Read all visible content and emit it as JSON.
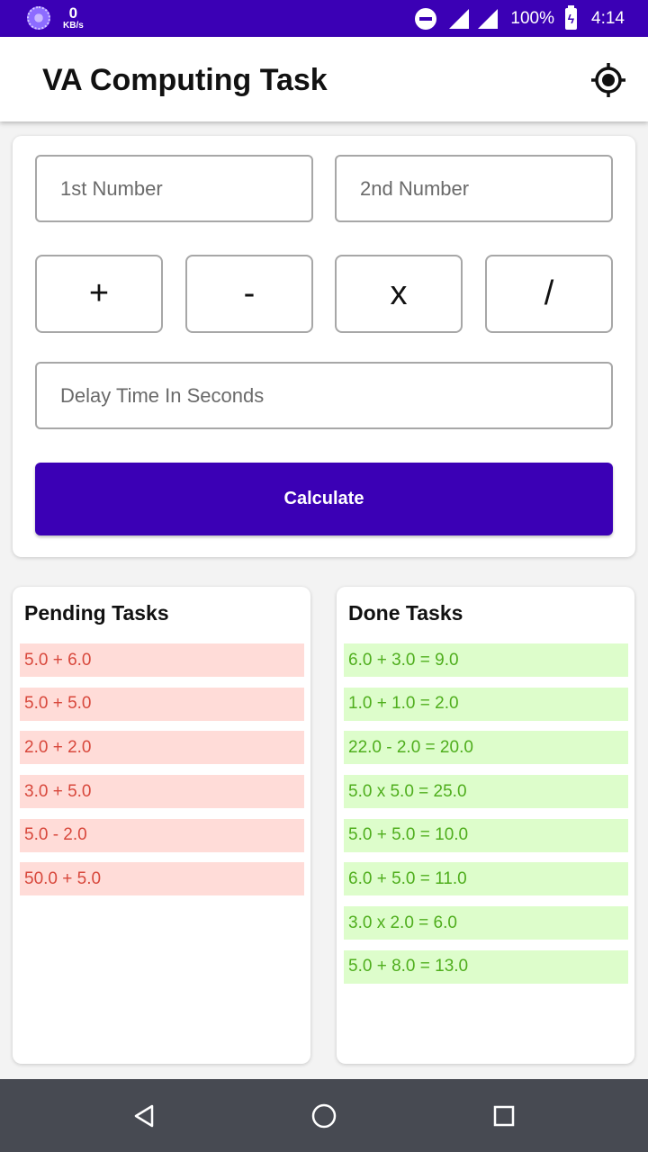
{
  "status_bar": {
    "net_speed_value": "0",
    "net_speed_unit": "KB/s",
    "battery": "100%",
    "time": "4:14",
    "icons": [
      "speed-indicator-icon",
      "do-not-disturb-icon",
      "signal-icon",
      "signal-icon",
      "battery-charging-icon"
    ]
  },
  "app_bar": {
    "title": "VA Computing Task",
    "action_icon": "my-location-icon"
  },
  "form": {
    "first_number_placeholder": "1st Number",
    "first_number_value": "",
    "second_number_placeholder": "2nd Number",
    "second_number_value": "",
    "operators": [
      "+",
      "-",
      "x",
      "/"
    ],
    "delay_placeholder": "Delay Time In Seconds",
    "delay_value": "",
    "calculate_label": "Calculate"
  },
  "pending": {
    "title": "Pending Tasks",
    "items": [
      "5.0 + 6.0",
      "5.0 + 5.0",
      "2.0 + 2.0",
      "3.0 + 5.0",
      "5.0 - 2.0",
      "50.0 + 5.0"
    ]
  },
  "done": {
    "title": "Done Tasks",
    "items": [
      "6.0 + 3.0 = 9.0",
      "1.0 + 1.0 = 2.0",
      "22.0 - 2.0 = 20.0",
      "5.0 x 5.0 = 25.0",
      "5.0 + 5.0 = 10.0",
      "6.0 + 5.0 = 11.0",
      "3.0 x 2.0 = 6.0",
      "5.0 + 8.0 = 13.0"
    ]
  },
  "nav_bar": {
    "icons": [
      "back-icon",
      "home-icon",
      "recents-icon"
    ]
  },
  "colors": {
    "primary": "#3b00b5",
    "pending_bg": "#ffdcd8",
    "pending_text": "#d8483c",
    "done_bg": "#ddfdcb",
    "done_text": "#4fae1d",
    "nav_bar": "#474a52"
  }
}
